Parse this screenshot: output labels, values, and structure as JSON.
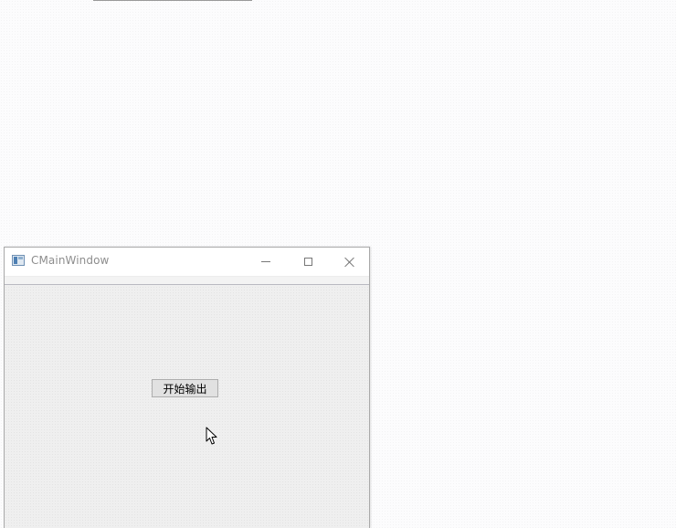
{
  "window": {
    "title": "CMainWindow",
    "icon": "app-window-icon"
  },
  "titlebar_buttons": {
    "minimize": "minimize-icon",
    "maximize": "maximize-icon",
    "close": "close-icon"
  },
  "main": {
    "start_button_label": "开始输出"
  },
  "colors": {
    "desktop": "#fbfbfc",
    "window_body": "#f0f0f0",
    "button_face": "#e1e1e1",
    "button_border": "#adadad",
    "title_text": "#8d8d8d"
  }
}
